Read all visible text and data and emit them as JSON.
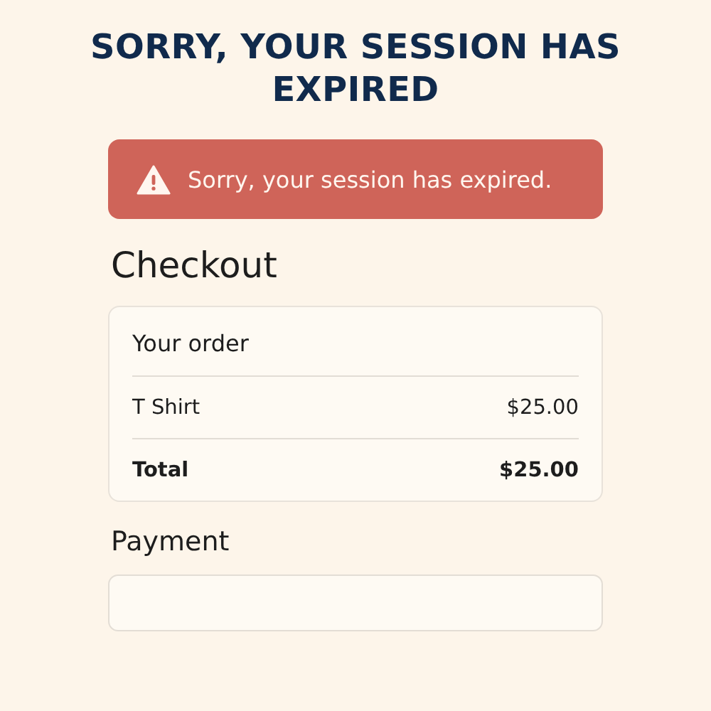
{
  "headline": "SORRY, YOUR SESSION HAS EXPIRED",
  "alert": {
    "message": "Sorry, your session has expired."
  },
  "heading": "Checkout",
  "order": {
    "title": "Your order",
    "rows": [
      {
        "kind": "item",
        "label": "T Shirt",
        "amount": "$25.00"
      },
      {
        "kind": "total",
        "label": "Total",
        "amount": "$25.00"
      }
    ]
  },
  "payment": {
    "label": "Payment"
  }
}
